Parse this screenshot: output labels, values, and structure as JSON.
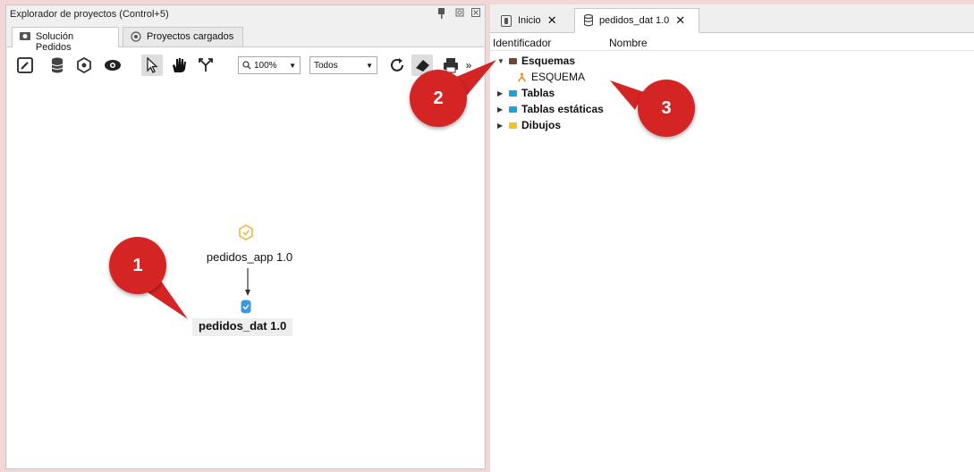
{
  "left_panel": {
    "title": "Explorador de proyectos (Control+5)",
    "tabs": [
      {
        "label": "Solución Pedidos",
        "icon": "solution-icon",
        "active": true
      },
      {
        "label": "Proyectos cargados",
        "icon": "loaded-projects-icon",
        "active": false
      }
    ],
    "toolbar": {
      "zoom": "100%",
      "filter": "Todos",
      "overflow": "»"
    },
    "diagram": {
      "app_node": "pedidos_app 1.0",
      "dat_node": "pedidos_dat 1.0"
    }
  },
  "right_panel": {
    "tabs": [
      {
        "label": "Inicio",
        "icon": "home-icon"
      },
      {
        "label": "pedidos_dat 1.0",
        "icon": "database-icon",
        "active": true
      }
    ],
    "columns": [
      "Identificador",
      "Nombre"
    ],
    "tree": {
      "esquemas": "Esquemas",
      "esquema_item": "ESQUEMA",
      "tablas": "Tablas",
      "tablas_estaticas": "Tablas estáticas",
      "dibujos": "Dibujos"
    }
  },
  "callouts": [
    "1",
    "2",
    "3"
  ],
  "colors": {
    "callout": "#d52424",
    "folder_brown": "#6b4a3a",
    "folder_blue": "#1ea0e0",
    "folder_yellow": "#f2c12e",
    "app_icon": "#f0b64a",
    "db_icon": "#3d9ad8"
  }
}
